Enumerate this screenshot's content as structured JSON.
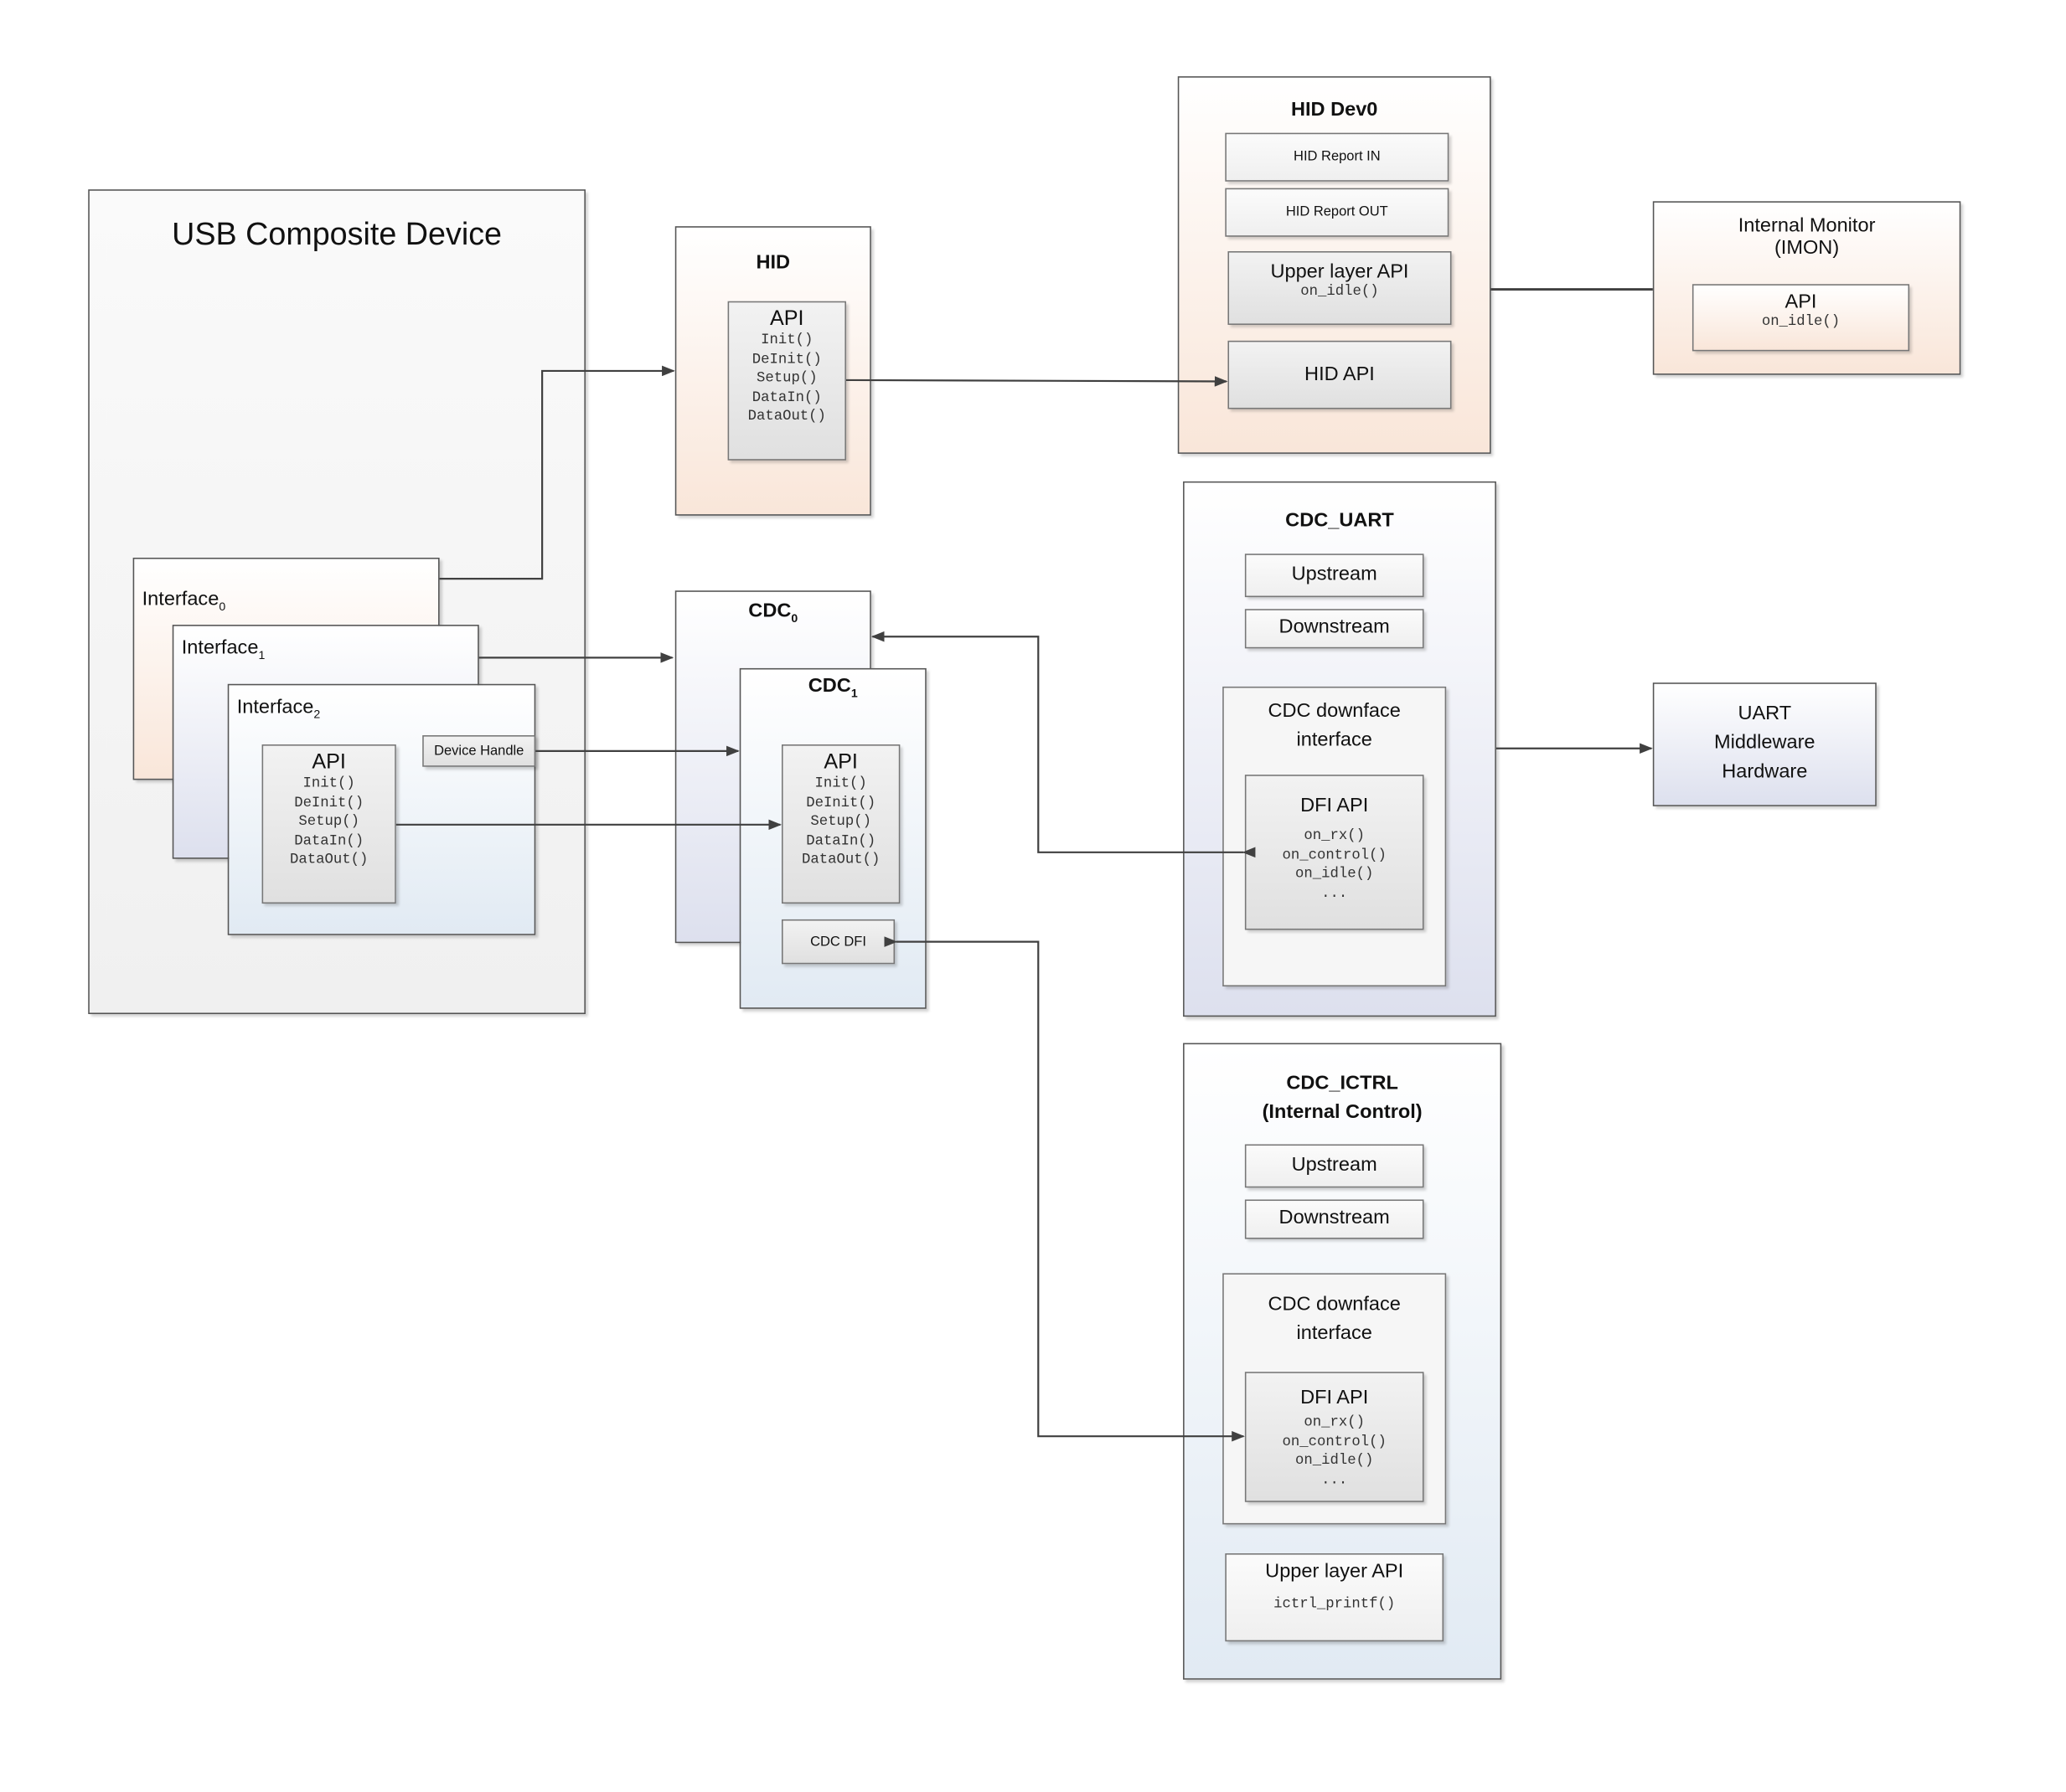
{
  "usb": {
    "title": "USB Composite Device",
    "interfaces": [
      {
        "name": "Interface",
        "sub": "0"
      },
      {
        "name": "Interface",
        "sub": "1"
      },
      {
        "name": "Interface",
        "sub": "2"
      }
    ],
    "device_handle": "Device Handle",
    "api": {
      "title": "API",
      "funcs": [
        "Init()",
        "DeInit()",
        "Setup()",
        "DataIn()",
        "DataOut()"
      ]
    }
  },
  "hid": {
    "title": "HID",
    "api": {
      "title": "API",
      "funcs": [
        "Init()",
        "DeInit()",
        "Setup()",
        "DataIn()",
        "DataOut()"
      ]
    }
  },
  "cdc0": {
    "name": "CDC",
    "sub": "0"
  },
  "cdc1": {
    "name": "CDC",
    "sub": "1",
    "api": {
      "title": "API",
      "funcs": [
        "Init()",
        "DeInit()",
        "Setup()",
        "DataIn()",
        "DataOut()"
      ]
    },
    "dfi": "CDC DFI"
  },
  "hid_dev0": {
    "title": "HID Dev0",
    "report_in": "HID Report IN",
    "report_out": "HID Report OUT",
    "upper_api": "Upper layer API",
    "upper_func": "on_idle()",
    "hid_api": "HID API"
  },
  "imon": {
    "title1": "Internal Monitor",
    "title2": "(IMON)",
    "api": "API",
    "func": "on_idle()"
  },
  "cdc_uart": {
    "title": "CDC_UART",
    "upstream": "Upstream",
    "downstream": "Downstream",
    "downface1": "CDC downface",
    "downface2": "interface",
    "dfi_api": "DFI API",
    "funcs": [
      "on_rx()",
      "on_control()",
      "on_idle()",
      "..."
    ]
  },
  "uart": {
    "lines": [
      "UART",
      "Middleware",
      "Hardware"
    ]
  },
  "cdc_ictrl": {
    "title1": "CDC_ICTRL",
    "title2": "(Internal Control)",
    "upstream": "Upstream",
    "downstream": "Downstream",
    "downface1": "CDC downface",
    "downface2": "interface",
    "dfi_api": "DFI API",
    "funcs": [
      "on_rx()",
      "on_control()",
      "on_idle()",
      "..."
    ],
    "upper_api": "Upper layer API",
    "upper_func": "ictrl_printf()"
  }
}
